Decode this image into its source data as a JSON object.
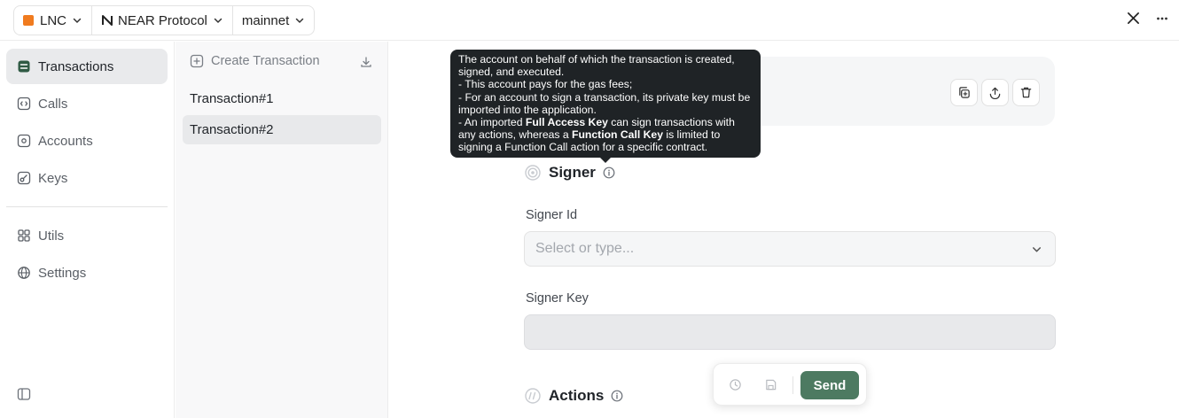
{
  "topbar": {
    "network_short": "LNC",
    "protocol": "NEAR Protocol",
    "network": "mainnet",
    "icons": [
      "x-logo-icon",
      "more-horizontal-icon"
    ]
  },
  "sidebar": {
    "items": [
      {
        "label": "Transactions",
        "icon": "transactions-icon",
        "active": true
      },
      {
        "label": "Calls",
        "icon": "code-icon"
      },
      {
        "label": "Accounts",
        "icon": "at-sign-icon"
      },
      {
        "label": "Keys",
        "icon": "key-icon"
      },
      {
        "label": "Utils",
        "icon": "grid-icon"
      },
      {
        "label": "Settings",
        "icon": "globe-icon"
      }
    ]
  },
  "transactions": {
    "create_label": "Create Transaction",
    "items": [
      "Transaction#1",
      "Transaction#2"
    ],
    "active_index": 1
  },
  "main": {
    "signer": {
      "title": "Signer",
      "signer_id_label": "Signer Id",
      "signer_id_placeholder": "Select or type...",
      "signer_key_label": "Signer Key"
    },
    "actions": {
      "title": "Actions"
    }
  },
  "sendbar": {
    "send_label": "Send"
  },
  "tooltip": {
    "line1": "The account on behalf of which the transaction is created, signed, and executed.",
    "line2": "- This account pays for the gas fees;",
    "line3": "- For an account to sign a transaction, its private key must be imported into the application.",
    "line4_pre": "- An imported ",
    "line4_bold1": "Full Access Key",
    "line4_mid": " can sign transactions with any actions, whereas a ",
    "line4_bold2": "Function Call Key",
    "line4_post": " is limited to signing a Function Call action for a specific contract."
  },
  "colors": {
    "accent": "#4d7a61",
    "lnc_badge": "#f07b1f",
    "tooltip_bg": "#1f2326"
  }
}
